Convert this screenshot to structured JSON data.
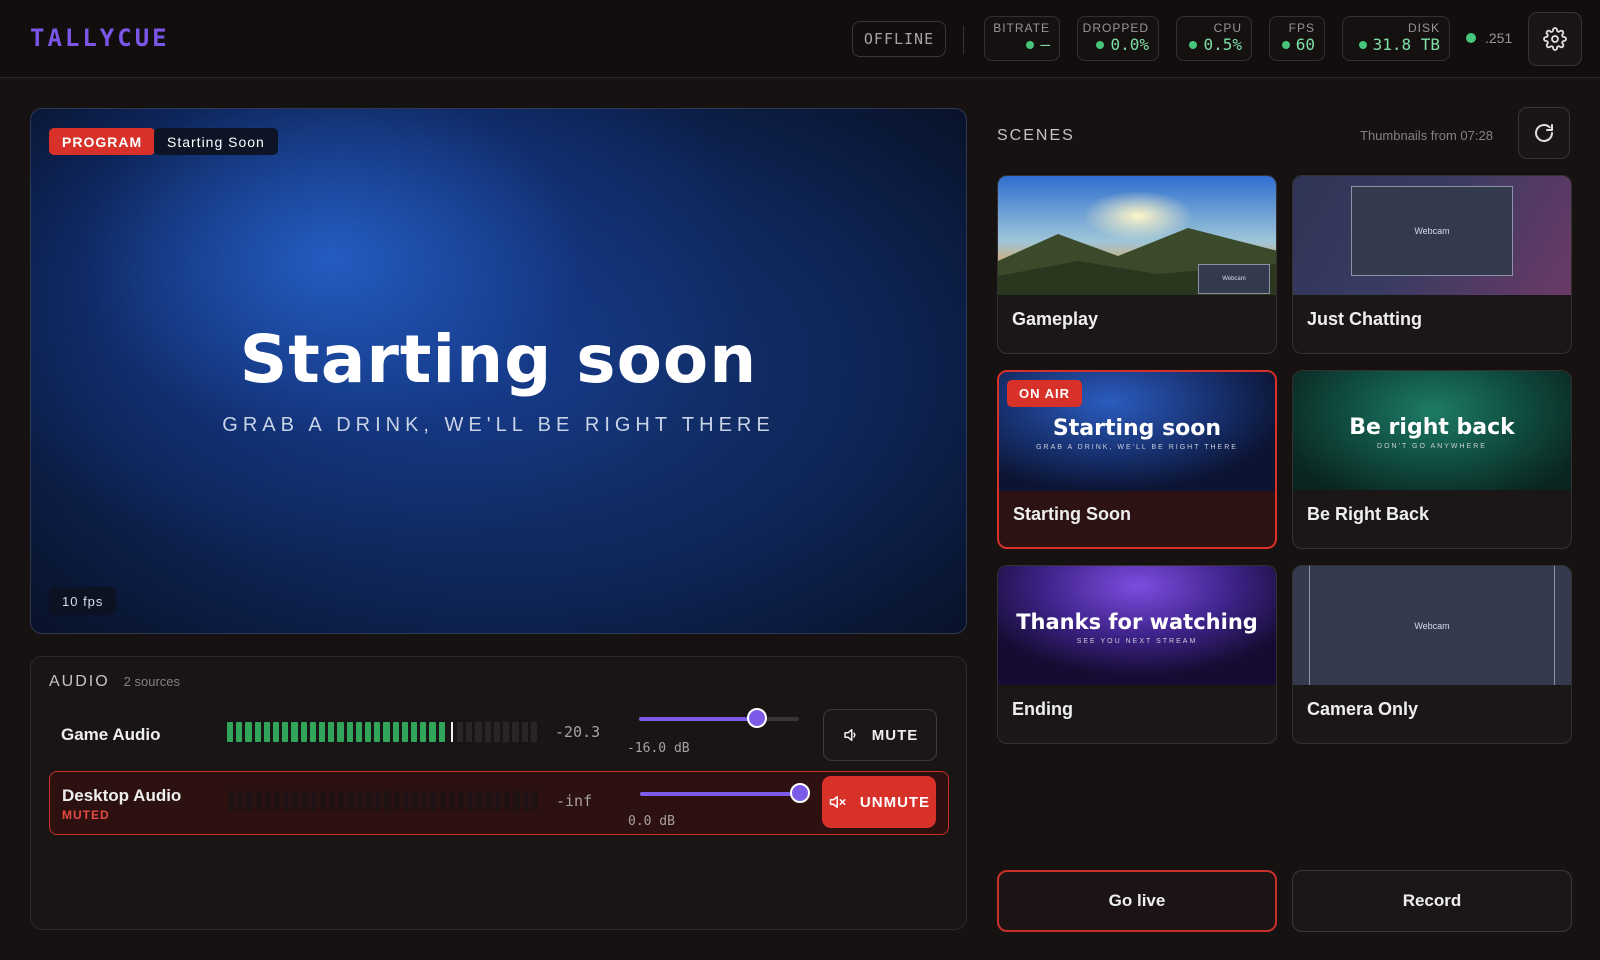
{
  "app": {
    "brand": "TALLYCUE"
  },
  "status": {
    "state": "OFFLINE",
    "stats": [
      {
        "label": "BITRATE",
        "value": "—"
      },
      {
        "label": "DROPPED",
        "value": "0.0%"
      },
      {
        "label": "CPU",
        "value": "0.5%"
      },
      {
        "label": "FPS",
        "value": "60"
      },
      {
        "label": "DISK",
        "value": "31.8 TB"
      }
    ],
    "ping": ".251"
  },
  "program": {
    "badge": "PROGRAM",
    "scene_name": "Starting Soon",
    "headline": "Starting soon",
    "subline": "GRAB A DRINK, WE'LL BE RIGHT THERE",
    "fps": "10 fps"
  },
  "audio": {
    "title": "AUDIO",
    "count": "2 sources",
    "sources": [
      {
        "name": "Game Audio",
        "status": "",
        "level_db": "-20.3",
        "meter_fill": 0.7,
        "peak": 0.72,
        "gain": "-16.0 dB",
        "fader": 0.74,
        "button": "MUTE",
        "muted": false
      },
      {
        "name": "Desktop Audio",
        "status": "MUTED",
        "level_db": "-inf",
        "meter_fill": 0,
        "peak": null,
        "gain": "0.0 dB",
        "fader": 1.0,
        "button": "UNMUTE",
        "muted": true
      }
    ]
  },
  "scenes": {
    "title": "SCENES",
    "note": "Thumbnails from 07:28",
    "on_air_label": "ON AIR",
    "items": [
      {
        "name": "Gameplay",
        "live": false,
        "thumb_caption": "Webcam"
      },
      {
        "name": "Just Chatting",
        "live": false,
        "thumb_caption": "Webcam"
      },
      {
        "name": "Starting Soon",
        "live": true,
        "thumb_title": "Starting soon",
        "thumb_sub": "GRAB A DRINK, WE'LL BE RIGHT THERE"
      },
      {
        "name": "Be Right Back",
        "live": false,
        "thumb_title": "Be right back",
        "thumb_sub": "DON'T GO ANYWHERE"
      },
      {
        "name": "Ending",
        "live": false,
        "thumb_title": "Thanks for watching",
        "thumb_sub": "SEE YOU NEXT STREAM"
      },
      {
        "name": "Camera Only",
        "live": false,
        "thumb_caption": "Webcam"
      }
    ]
  },
  "actions": {
    "go_live": "Go live",
    "record": "Record"
  },
  "colors": {
    "accent": "#7b55e6",
    "live_red": "#d8312a",
    "ok_green": "#46c67a"
  }
}
